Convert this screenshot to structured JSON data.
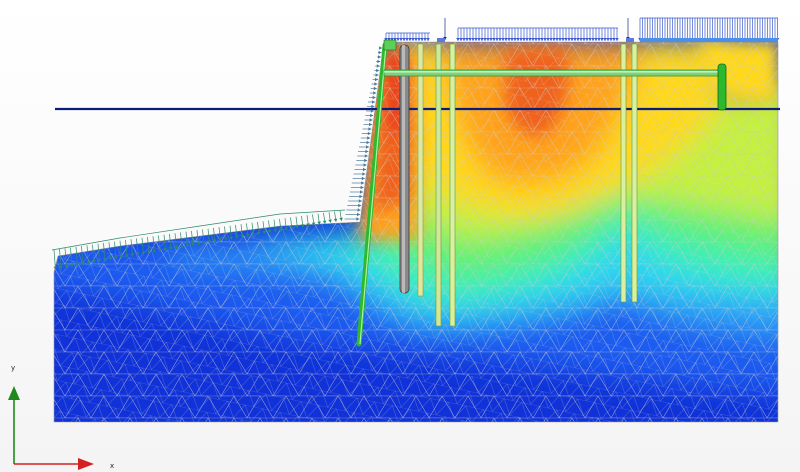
{
  "axes": {
    "x_label": "x",
    "y_label": "y",
    "x_color": "#d42020",
    "y_color": "#1e8a1e"
  },
  "colors": {
    "deep_blue": "#1032d8",
    "blue": "#1e5cf0",
    "light_blue": "#2f9cf6",
    "cyan": "#2fd6f0",
    "aqua_green": "#3ef0b4",
    "green": "#62f070",
    "yellow_green": "#c4f040",
    "yellow": "#ffd81e",
    "orange": "#ffa21e",
    "red_orange": "#f0621a",
    "red": "#e8281a",
    "water_line": "#0a1e78",
    "structure_green": "#2eb82e",
    "load_arrows": "#2a8a6a",
    "surface_load": "#3a5ad0"
  }
}
